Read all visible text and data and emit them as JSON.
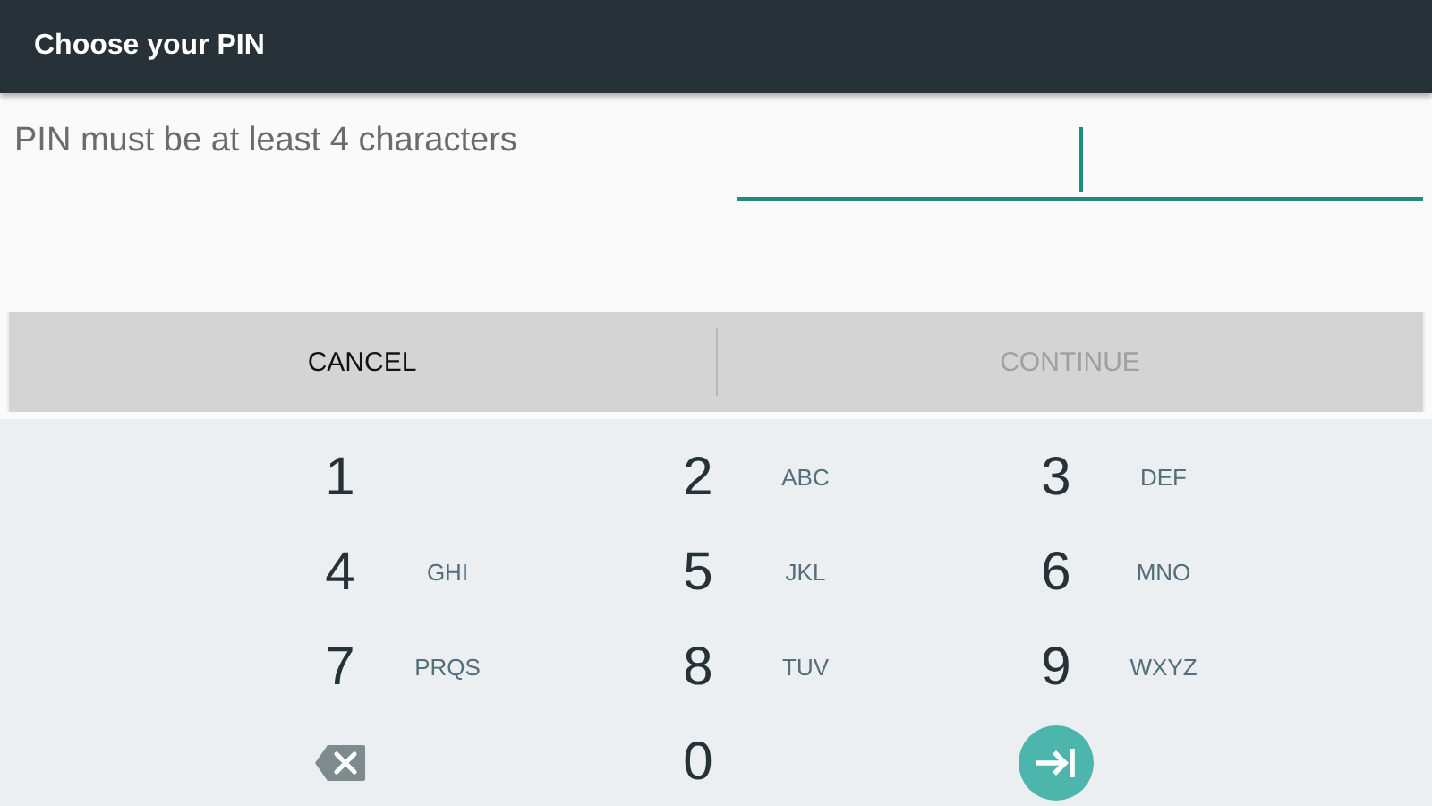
{
  "window": {
    "title": "Choose your PIN"
  },
  "message": "PIN must be at least 4 characters",
  "pin_field": {
    "focused": true
  },
  "buttons": [
    {
      "label": "CANCEL",
      "disabled": false
    },
    {
      "label": "CONTINUE",
      "disabled": true
    }
  ],
  "keypad": [
    {
      "kind": "digit",
      "digit": "1"
    },
    {
      "kind": "digit",
      "digit": "2",
      "letters": "ABC"
    },
    {
      "kind": "digit",
      "digit": "3",
      "letters": "DEF"
    },
    {
      "kind": "digit",
      "digit": "4",
      "letters": "GHI"
    },
    {
      "kind": "digit",
      "digit": "5",
      "letters": "JKL"
    },
    {
      "kind": "digit",
      "digit": "6",
      "letters": "MNO"
    },
    {
      "kind": "digit",
      "digit": "7",
      "letters": "PRQS"
    },
    {
      "kind": "digit",
      "digit": "8",
      "letters": "TUV"
    },
    {
      "kind": "digit",
      "digit": "9",
      "letters": "WXYZ"
    },
    {
      "kind": "backspace"
    },
    {
      "kind": "digit",
      "digit": "0"
    },
    {
      "kind": "enter"
    }
  ]
}
